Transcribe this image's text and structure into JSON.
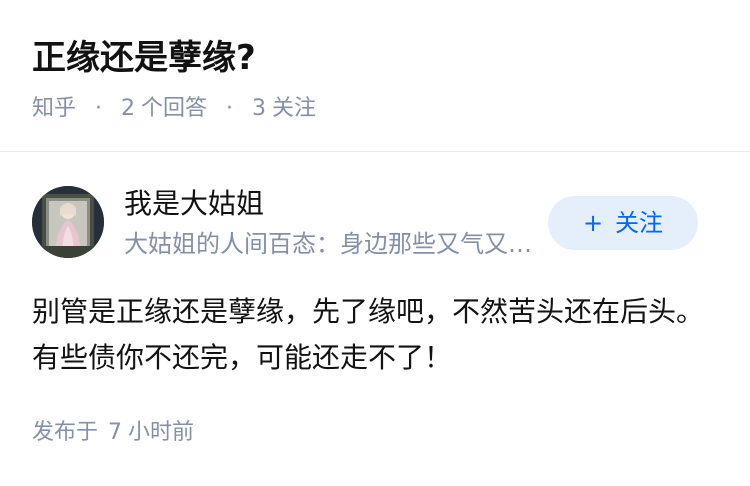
{
  "question": {
    "title": "正缘还是孽缘?",
    "source": "知乎",
    "answer_count": "2",
    "answer_label": "个回答",
    "follower_count": "3",
    "follower_label": "关注"
  },
  "answer": {
    "author": {
      "name": "我是大姑姐",
      "bio": "大姑姐的人间百态：身边那些又气又好笑的事"
    },
    "follow_button": {
      "label": "关注",
      "icon": "plus-icon"
    },
    "content": "别管是正缘还是孽缘，先了缘吧，不然苦头还在后头。有些债你不还完，可能还走不了！",
    "publish": {
      "prefix": "发布于",
      "value": "7",
      "unit": "小时前"
    }
  },
  "colors": {
    "text_primary": "#121212",
    "text_secondary": "#8590a6",
    "accent": "#0066ff",
    "follow_bg": "#e5eefb",
    "divider": "#ebebeb"
  }
}
